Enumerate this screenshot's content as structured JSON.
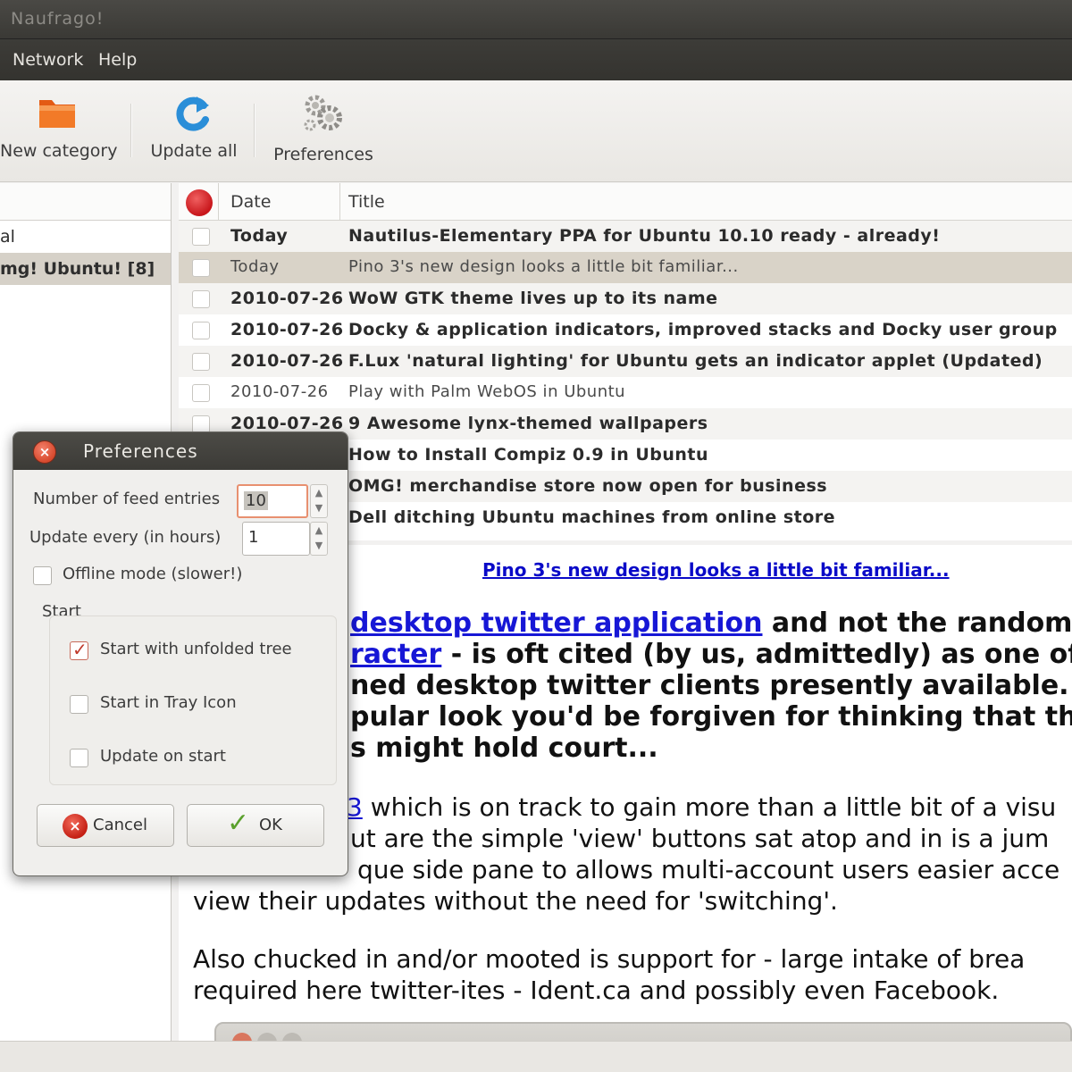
{
  "window": {
    "title": "Naufrago!"
  },
  "menu": {
    "items": [
      "Network",
      "Help"
    ]
  },
  "toolbar": {
    "new_category": "New category",
    "update_all": "Update all",
    "preferences": "Preferences"
  },
  "sidebar": {
    "items": [
      {
        "label": "al"
      },
      {
        "label": "mg! Ubuntu! [8]",
        "selected": true
      }
    ]
  },
  "feed_list": {
    "headers": {
      "date": "Date",
      "title": "Title"
    },
    "rows": [
      {
        "date": "Today",
        "title": "Nautilus-Elementary PPA for Ubuntu 10.10 ready - already!",
        "unread": true
      },
      {
        "date": "Today",
        "title": "Pino 3's new design looks a little bit familiar...",
        "unread": false,
        "selected": true
      },
      {
        "date": "2010-07-26",
        "title": "WoW GTK theme lives up to its name",
        "unread": true
      },
      {
        "date": "2010-07-26",
        "title": "Docky & application indicators, improved stacks and Docky user group",
        "unread": true
      },
      {
        "date": "2010-07-26",
        "title": "F.Lux 'natural lighting' for Ubuntu gets an indicator applet (Updated)",
        "unread": true
      },
      {
        "date": "2010-07-26",
        "title": "Play with Palm WebOS in Ubuntu",
        "unread": false
      },
      {
        "date": "2010-07-26",
        "title": "9 Awesome lynx-themed wallpapers",
        "unread": true
      },
      {
        "date": "",
        "title": "How to Install Compiz 0.9 in Ubuntu",
        "unread": true
      },
      {
        "date": "",
        "title": "OMG! merchandise store now open for business",
        "unread": true
      },
      {
        "date": "",
        "title": "Dell ditching Ubuntu machines from online store",
        "unread": true
      }
    ]
  },
  "article": {
    "link": "Pino 3's new design looks a little bit familiar...",
    "p1_link1": "desktop twitter application",
    "p1_line1_rest": " and not the random",
    "p1_link2": "racter",
    "p1_line2_rest": " - is oft cited (by us, admittedly) as one of",
    "p1_line3": "ned desktop twitter clients presently available. V",
    "p1_line4": "pular look you'd be forgiven for thinking that the",
    "p1_line5": "s might hold court...",
    "p2_link": "3",
    "p2_line1_rest": " which is on track to gain more than a little bit of a visu",
    "p2_line2": "ut are the simple 'view' buttons sat atop and in is a jum",
    "p2_line3": "que side pane to allows multi-account users easier acce",
    "p2_line4": "view their updates without the need for 'switching'.",
    "p3_line1": "Also chucked in and/or mooted is support for - large intake of brea",
    "p3_line2": "required here twitter-ites - Ident.ca and possibly even Facebook."
  },
  "preferences_dialog": {
    "title": "Preferences",
    "feed_entries_label": "Number of feed entries",
    "feed_entries_value": "10",
    "update_every_label": "Update every (in hours)",
    "update_every_value": "1",
    "offline_label": "Offline mode (slower!)",
    "offline_checked": false,
    "start_group_label": "Start",
    "unfolded_label": "Start with unfolded tree",
    "unfolded_checked": true,
    "tray_label": "Start in Tray Icon",
    "tray_checked": false,
    "update_start_label": "Update on start",
    "update_start_checked": false,
    "cancel_label": "Cancel",
    "ok_label": "OK"
  }
}
